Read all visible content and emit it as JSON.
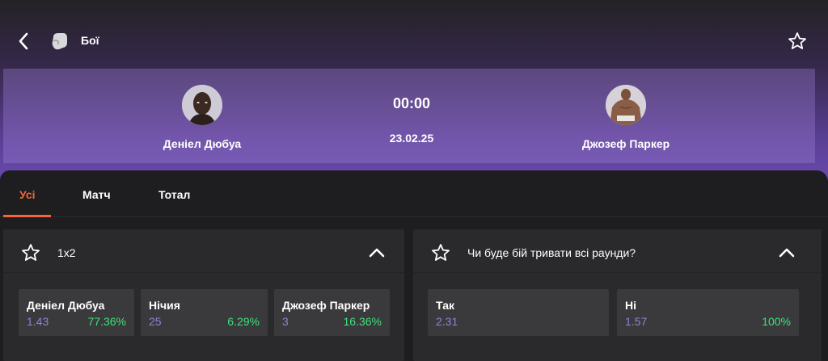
{
  "header": {
    "title": "Бої",
    "back_icon": "chevron-left-icon",
    "sport_icon": "boxing-glove-icon",
    "favorite_icon": "star-outline-icon"
  },
  "match": {
    "home": {
      "name": "Деніел Дюбуа",
      "avatar": "fighter-avatar"
    },
    "away": {
      "name": "Джозеф Паркер",
      "avatar": "fighter-avatar"
    },
    "time": "00:00",
    "date": "23.02.25"
  },
  "tabs": [
    {
      "label": "Усі",
      "active": true
    },
    {
      "label": "Матч",
      "active": false
    },
    {
      "label": "Тотал",
      "active": false
    }
  ],
  "markets": [
    {
      "title": "1x2",
      "outcomes": [
        {
          "label": "Деніел Дюбуа",
          "coef": "1.43",
          "percent": "77.36%"
        },
        {
          "label": "Нічия",
          "coef": "25",
          "percent": "6.29%"
        },
        {
          "label": "Джозеф Паркер",
          "coef": "3",
          "percent": "16.36%"
        }
      ]
    },
    {
      "title": "Чи буде бій тривати всі раунди?",
      "outcomes": [
        {
          "label": "Так",
          "coef": "2.31",
          "percent": ""
        },
        {
          "label": "Ні",
          "coef": "1.57",
          "percent": "100%"
        }
      ]
    }
  ],
  "colors": {
    "accent": "#f0663a",
    "coef": "#8c84d4",
    "percent": "#3ee07a",
    "hero_purple": "#6a4bb0"
  }
}
